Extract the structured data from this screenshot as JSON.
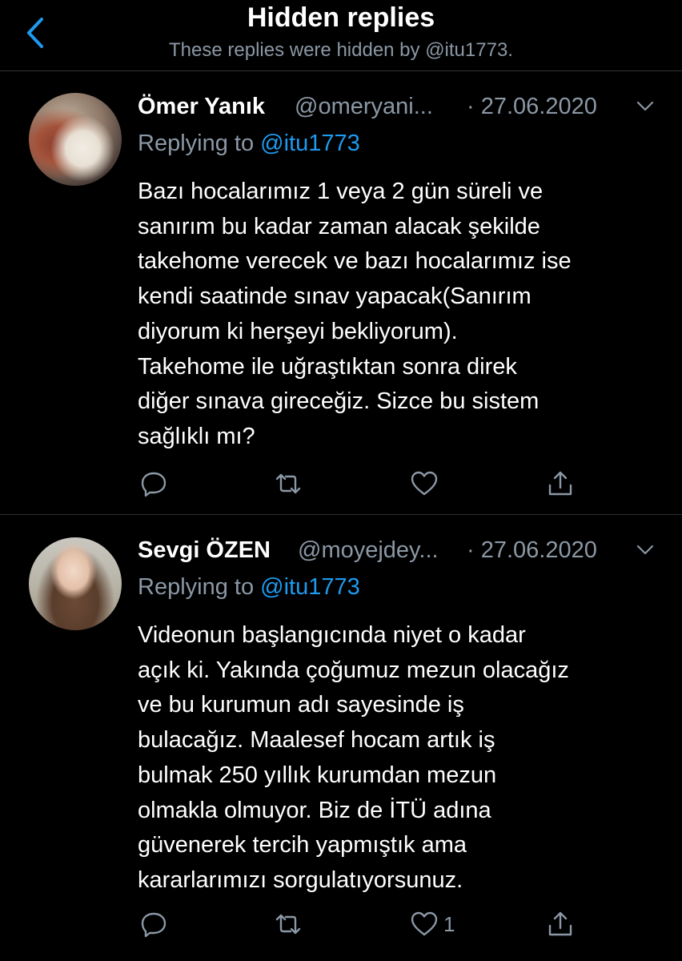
{
  "header": {
    "title": "Hidden replies",
    "subtitle": "These replies were hidden by @itu1773."
  },
  "tweets": [
    {
      "name": "Ömer Yanık",
      "handle": "@omeryani...",
      "date": "· 27.06.2020",
      "replying_prefix": "Replying to ",
      "replying_to": "@itu1773",
      "lines": [
        "Bazı hocalarımız 1 veya 2 gün süreli ve",
        "sanırım bu kadar zaman alacak şekilde",
        "takehome verecek ve bazı hocalarımız ise",
        "kendi saatinde sınav yapacak(Sanırım",
        "diyorum ki herşeyi bekliyorum).",
        "Takehome ile uğraştıktan sonra direk",
        "diğer sınava gireceğiz. Sizce bu sistem",
        "sağlıklı mı?"
      ],
      "like_count": ""
    },
    {
      "name": "Sevgi ÖZEN",
      "handle": "@moyejdey...",
      "date": "· 27.06.2020",
      "replying_prefix": "Replying to ",
      "replying_to": "@itu1773",
      "lines": [
        "Videonun başlangıcında niyet o kadar",
        "açık ki. Yakında çoğumuz mezun olacağız",
        "ve bu kurumun adı sayesinde iş",
        "bulacağız. Maalesef hocam artık iş",
        "bulmak 250 yıllık kurumdan mezun",
        "olmakla olmuyor. Biz de İTÜ adına",
        "güvenerek tercih yapmıştık ama",
        "kararlarımızı sorgulatıyorsunuz."
      ],
      "like_count": "1"
    }
  ],
  "colors": {
    "background": "#000000",
    "text": "#ffffff",
    "secondary": "#8b98a5",
    "accent": "#1d9bf0",
    "divider": "#2f3336"
  },
  "icons": {
    "back": "chevron-left-icon",
    "more": "chevron-down-icon",
    "reply": "reply-icon",
    "retweet": "retweet-icon",
    "like": "heart-icon",
    "share": "share-icon"
  }
}
